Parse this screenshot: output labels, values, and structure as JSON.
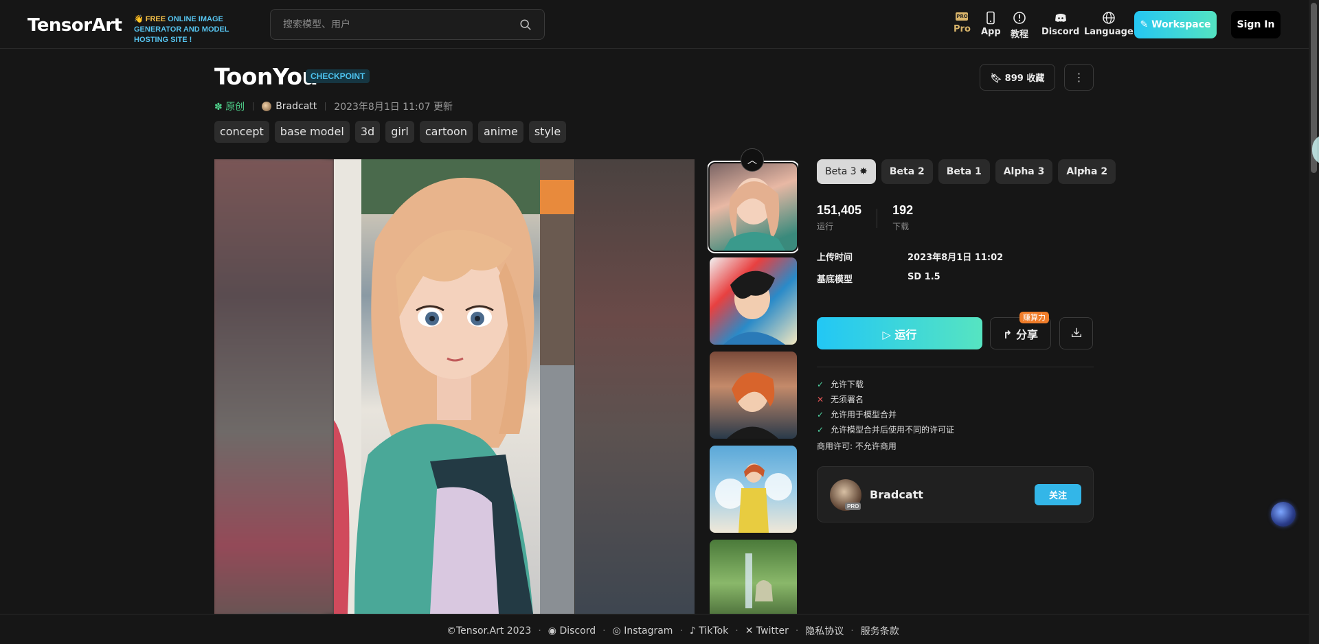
{
  "header": {
    "logo": "TensorArt",
    "promo_free": "FREE",
    "promo_text": " ONLINE IMAGE GENERATOR AND MODEL HOSTING SITE !",
    "search_placeholder": "搜索模型、用户",
    "nav": [
      {
        "label": "Pro",
        "icon": "pro-badge-icon"
      },
      {
        "label": "App",
        "icon": "phone-icon"
      },
      {
        "label": "教程",
        "icon": "info-icon"
      },
      {
        "label": "Discord",
        "icon": "discord-icon"
      },
      {
        "label": "Language",
        "icon": "globe-icon"
      }
    ],
    "pro_badge": "PRO",
    "workspace_label": "Workspace",
    "signin_label": "Sign In"
  },
  "model": {
    "title": "ToonYou",
    "type": "CHECKPOINT",
    "original_label": "原创",
    "author": "Bradcatt",
    "updated": "2023年8月1日 11:07 更新",
    "tags": [
      "concept",
      "base model",
      "3d",
      "girl",
      "cartoon",
      "anime",
      "style"
    ],
    "favorites_label": "899 收藏"
  },
  "versions": {
    "items": [
      {
        "label": "Beta 3",
        "active": true
      },
      {
        "label": "Beta 2",
        "active": false
      },
      {
        "label": "Beta 1",
        "active": false
      },
      {
        "label": "Alpha 3",
        "active": false
      },
      {
        "label": "Alpha 2",
        "active": false
      }
    ]
  },
  "stats": {
    "runs": "151,405",
    "runs_label": "运行",
    "downloads": "192",
    "downloads_label": "下载"
  },
  "details": {
    "upload_label": "上传时间",
    "upload_value": "2023年8月1日 11:02",
    "base_label": "基底模型",
    "base_value": "SD 1.5"
  },
  "actions": {
    "run_label": "运行",
    "share_label": "分享",
    "share_badge": "赚算力"
  },
  "permissions": [
    {
      "text": "允许下载",
      "allowed": true
    },
    {
      "text": "无须署名",
      "allowed": false
    },
    {
      "text": "允许用于模型合并",
      "allowed": true
    },
    {
      "text": "允许模型合并后使用不同的许可证",
      "allowed": true
    }
  ],
  "commercial": "商用许可: 不允许商用",
  "author_card": {
    "name": "Bradcatt",
    "pro": "PRO",
    "follow_label": "关注"
  },
  "footer": {
    "copyright": "©Tensor.Art 2023",
    "links": [
      "Discord",
      "Instagram",
      "TikTok",
      "Twitter",
      "隐私协议",
      "服务条款"
    ]
  },
  "colors": {
    "accent_gradient_start": "#22c7f5",
    "accent_gradient_end": "#56e4c1",
    "badge_orange": "#f07d2a",
    "follow_blue": "#33b6e8",
    "original_green": "#4fd18b"
  }
}
